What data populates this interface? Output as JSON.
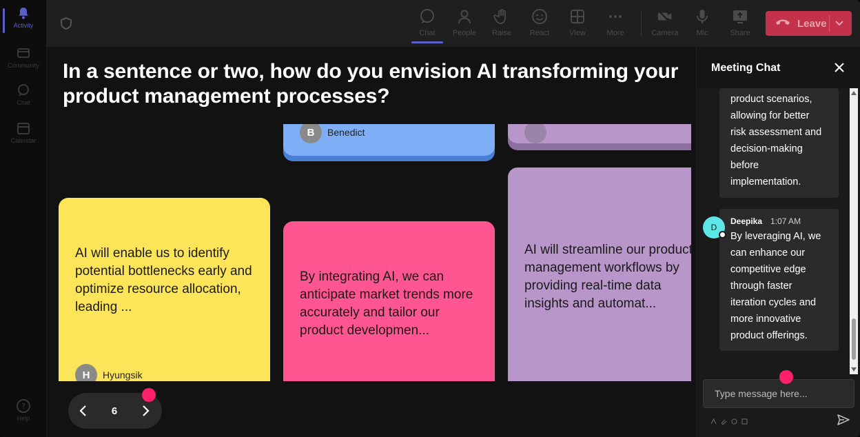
{
  "rail": {
    "items": [
      {
        "label": "Activity",
        "icon": "bell-icon",
        "active": true
      },
      {
        "label": "Community",
        "icon": "community-icon",
        "active": false
      },
      {
        "label": "Chat",
        "icon": "chat-icon",
        "active": false
      },
      {
        "label": "Calendar",
        "icon": "calendar-icon",
        "active": false
      }
    ],
    "help": "Help"
  },
  "toolbar": {
    "chat": "Chat",
    "people": "People",
    "raise": "Raise",
    "react": "React",
    "view": "View",
    "more": "More",
    "camera": "Camera",
    "mic": "Mic",
    "share": "Share",
    "leave": "Leave"
  },
  "stage": {
    "question": "In a sentence or two, how do you envision AI transforming your product management processes?",
    "cards": [
      {
        "author": "Benedict",
        "initial": "B",
        "text": "",
        "color": "#7eaef5"
      },
      {
        "author": "",
        "initial": "",
        "text": "",
        "color": "#b996c9"
      },
      {
        "author": "Hyungsik",
        "initial": "H",
        "text": "AI will enable us to identify potential bottlenecks early and optimize resource allocation, leading ...",
        "color": "#fde55a"
      },
      {
        "author": "",
        "initial": "",
        "text": "By integrating AI, we can anticipate market trends more accurately and tailor our product developmen...",
        "color": "#ff5591"
      },
      {
        "author": "",
        "initial": "",
        "text": "AI will streamline our product management workflows by providing real-time data insights and automat...",
        "color": "#b996c9"
      }
    ],
    "page": "6"
  },
  "chat": {
    "title": "Meeting Chat",
    "messages": [
      {
        "author": "",
        "time": "",
        "text": "product scenarios, allowing for better risk assessment and decision-making before implementation."
      },
      {
        "author": "Deepika",
        "initial": "D",
        "time": "1:07 AM",
        "text": "By leveraging AI, we can enhance our competitive edge through faster iteration cycles and more innovative product offerings."
      }
    ],
    "input_placeholder": "Type message here..."
  },
  "colors": {
    "accent": "#5b5fc7",
    "leave": "#c4314b",
    "pointer_dot": "#ff1f6b"
  }
}
